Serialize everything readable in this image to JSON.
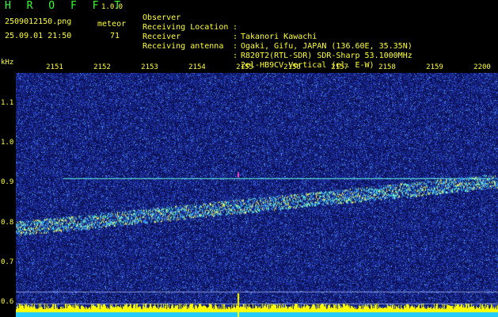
{
  "header": {
    "app_title": "H R O F F T",
    "app_version": "1.0.0",
    "filename": "2509012150.png",
    "meteor_label": "meteor",
    "datetime": "25.09.01 21:50",
    "meteor_count": "71"
  },
  "info": [
    {
      "key": "Observer",
      "sep": ":",
      "value": "Takanori Kawachi"
    },
    {
      "key": "Receiving Location",
      "sep": ":",
      "value": "Ogaki, Gifu, JAPAN (136.60E, 35.35N)"
    },
    {
      "key": "Receiver",
      "sep": ":",
      "value": "R820T2(RTL-SDR) SDR-Sharp 53.1000MHz"
    },
    {
      "key": "Receiving antenna",
      "sep": ":",
      "value": "2el-HB9CV Vertical (el. E-W)"
    }
  ],
  "axes": {
    "y_unit": "kHz",
    "time_labels": [
      "2151",
      "2152",
      "2153",
      "2154",
      "2155",
      "2156",
      "2157",
      "2158",
      "2159",
      "2200"
    ],
    "freq_labels": [
      "1.1",
      "1.0",
      "0.9",
      "0.8",
      "0.7",
      "0.6"
    ],
    "freq_values": [
      1.1,
      1.0,
      0.9,
      0.8,
      0.7,
      0.6
    ]
  },
  "colors": {
    "background": "#000000",
    "text_yellow": "#ffff33",
    "title_green": "#33ff33",
    "noise_blue": "#1a2a9a",
    "trace_cyan": "#55ffdd",
    "bottom_fill": "#ffff00",
    "bottom_cyan": "#22ccff"
  }
}
